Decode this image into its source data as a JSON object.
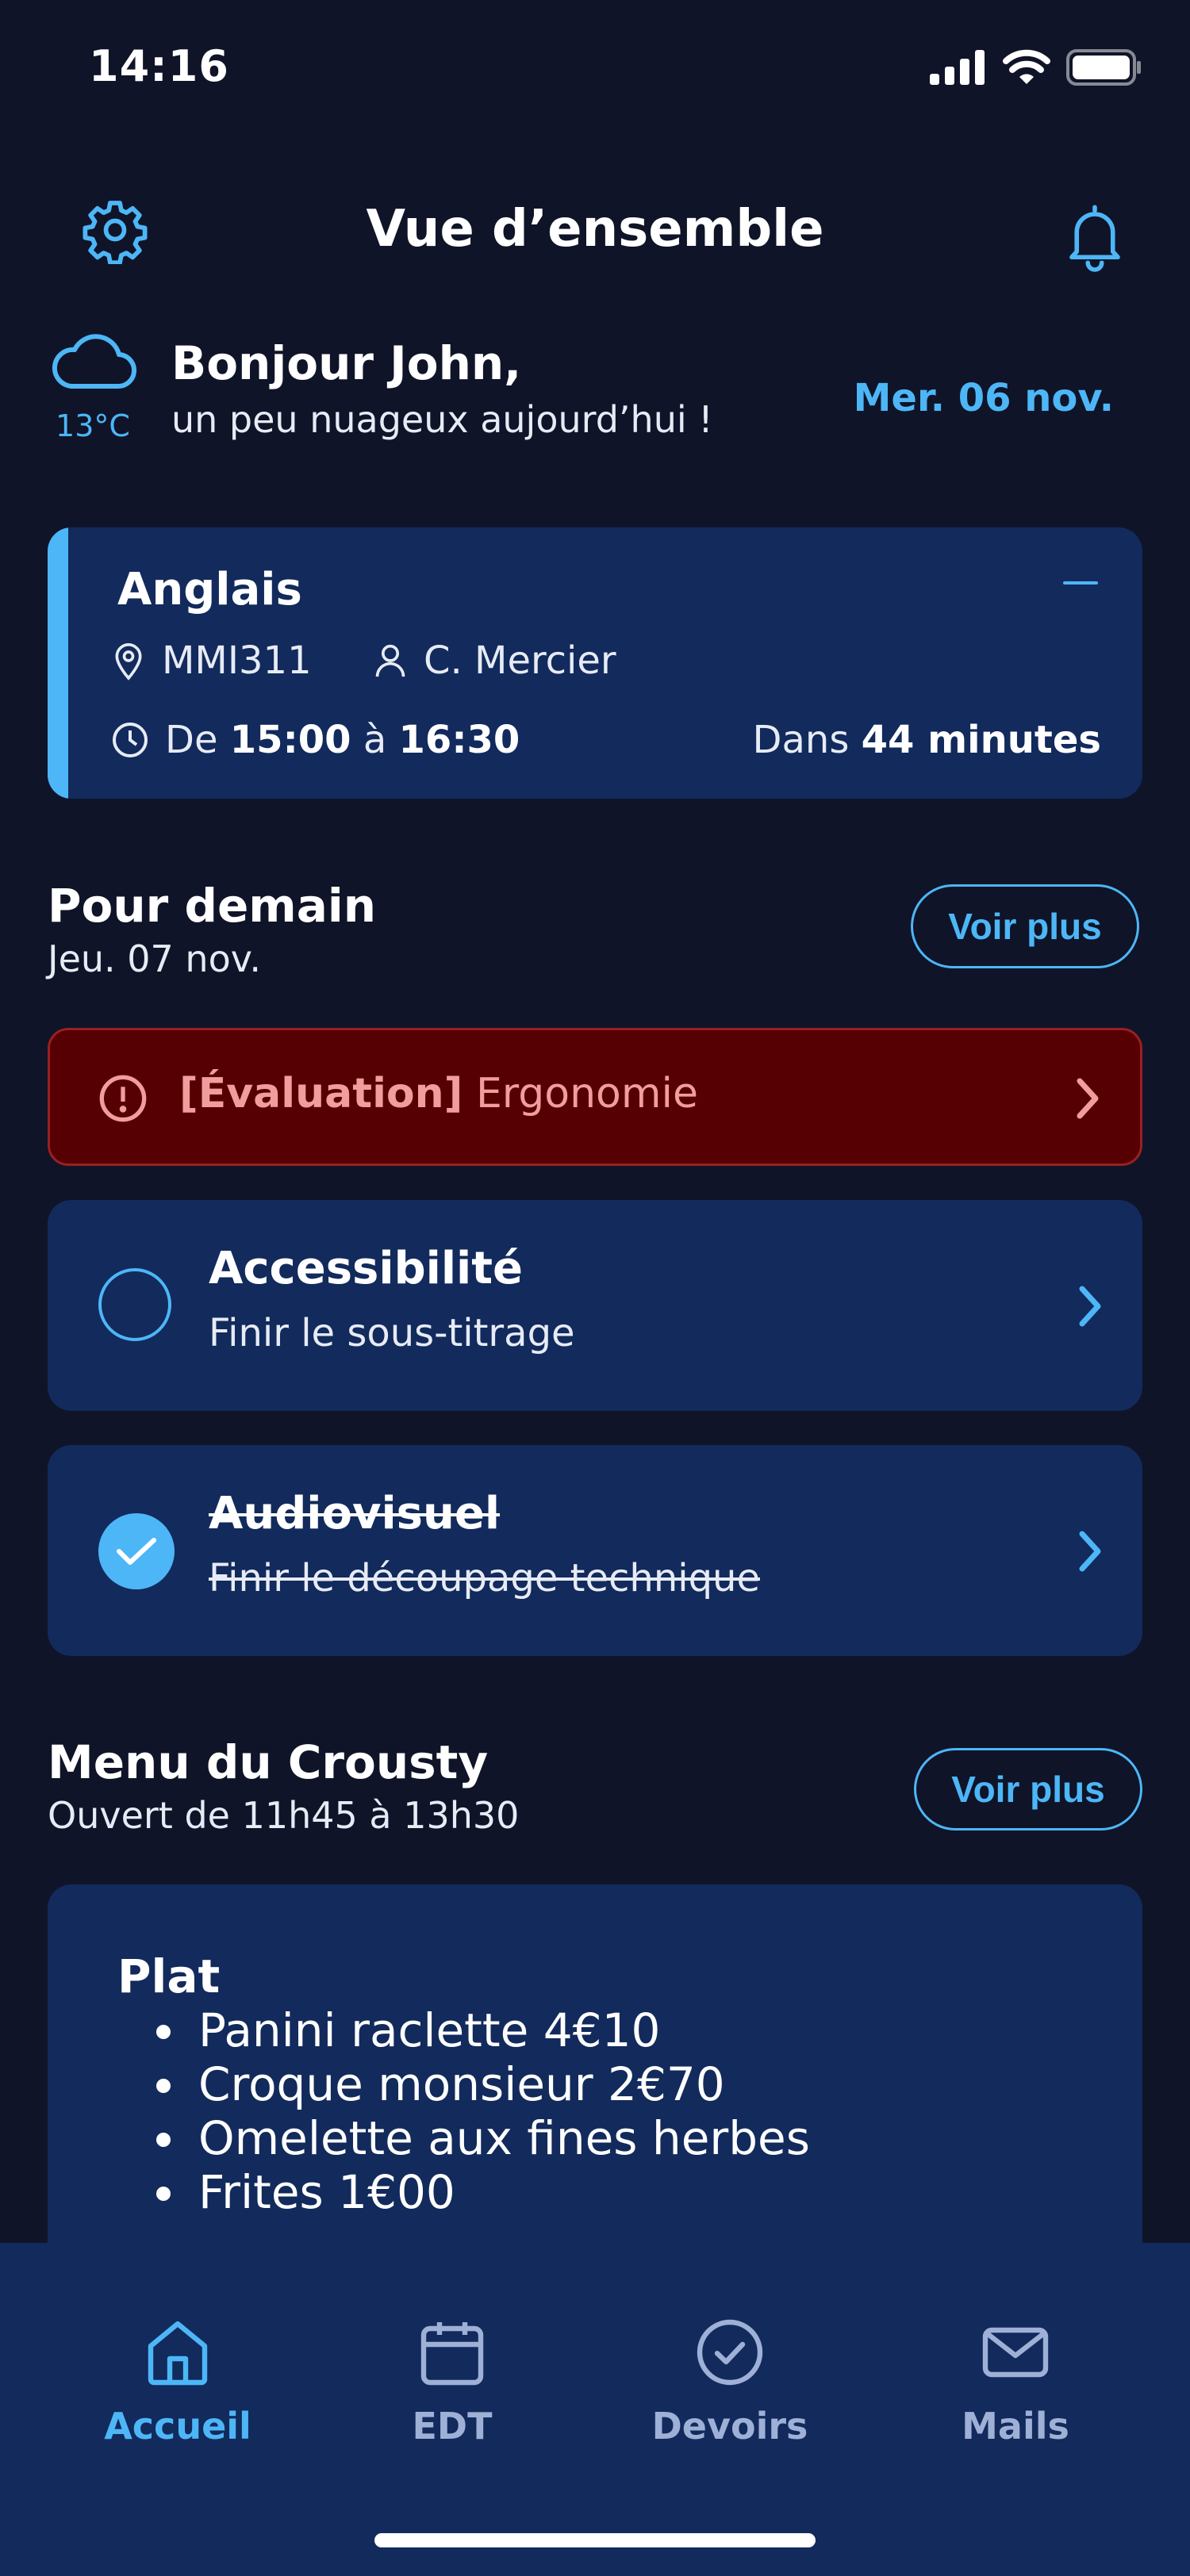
{
  "status_bar": {
    "time": "14:16"
  },
  "header": {
    "title": "Vue d’ensemble"
  },
  "greeting": {
    "temperature": "13°C",
    "title": "Bonjour John,",
    "subtitle": "un peu nuageux aujourd’hui !",
    "date": "Mer. 06 nov."
  },
  "current_course": {
    "subject": "Anglais",
    "room": "MMI311",
    "teacher": "C. Mercier",
    "time_prefix": "De",
    "start": "15:00",
    "time_separator": "à",
    "end": "16:30",
    "countdown_prefix": "Dans",
    "countdown": "44 minutes"
  },
  "tomorrow": {
    "title": "Pour demain",
    "date": "Jeu. 07 nov.",
    "more_label": "Voir plus",
    "evaluation": {
      "tag": "[Évaluation]",
      "subject": "Ergonomie"
    },
    "tasks": [
      {
        "subject": "Accessibilité",
        "description": "Finir le sous-titrage",
        "done": false
      },
      {
        "subject": "Audiovisuel",
        "description": "Finir le découpage technique",
        "done": true
      }
    ]
  },
  "menu": {
    "title": "Menu du Crousty",
    "hours": "Ouvert de 11h45 à 13h30",
    "more_label": "Voir plus",
    "section": "Plat",
    "items": [
      "Panini raclette 4€10",
      "Croque monsieur 2€70",
      "Omelette aux fines herbes",
      "Frites 1€00"
    ]
  },
  "tabs": [
    {
      "label": "Accueil",
      "icon": "home-icon",
      "active": true
    },
    {
      "label": "EDT",
      "icon": "calendar-icon",
      "active": false
    },
    {
      "label": "Devoirs",
      "icon": "check-circle-icon",
      "active": false
    },
    {
      "label": "Mails",
      "icon": "mail-icon",
      "active": false
    }
  ],
  "colors": {
    "background": "#0f1428",
    "card": "#122a5c",
    "accent": "#4db6f7",
    "alert": "#560003"
  }
}
